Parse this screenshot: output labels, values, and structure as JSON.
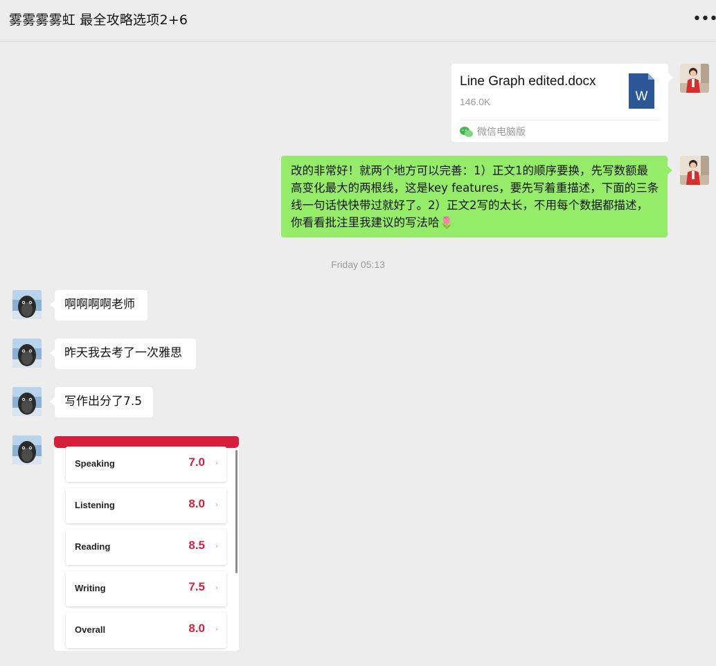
{
  "header": {
    "title": "雾雾雾雾虹 最全攻略选项2+6",
    "more_icon": "more-dots-icon"
  },
  "messages": {
    "file": {
      "name": "Line Graph edited.docx",
      "size": "146.0K",
      "source": "微信电脑版",
      "icon": "word-doc-icon"
    },
    "teacher_reply": "改的非常好！就两个地方可以完善：1）正文1的顺序要换，先写数额最高变化最大的两根线，这是key features，要先写着重描述，下面的三条线一句话快快带过就好了。2）正文2写的太长，不用每个数据都描述，你看看批注里我建议的写法哈🌷",
    "timestamp": "Friday 05:13",
    "student": [
      "啊啊啊啊老师",
      "昨天我去考了一次雅思",
      "写作出分了7.5"
    ]
  },
  "scores": [
    {
      "label": "Speaking",
      "value": "7.0"
    },
    {
      "label": "Listening",
      "value": "8.0"
    },
    {
      "label": "Reading",
      "value": "8.5"
    },
    {
      "label": "Writing",
      "value": "7.5"
    },
    {
      "label": "Overall",
      "value": "8.0"
    }
  ],
  "colors": {
    "background": "#ededed",
    "sent_bubble": "#95ec69",
    "score_red": "#d81e3d"
  }
}
